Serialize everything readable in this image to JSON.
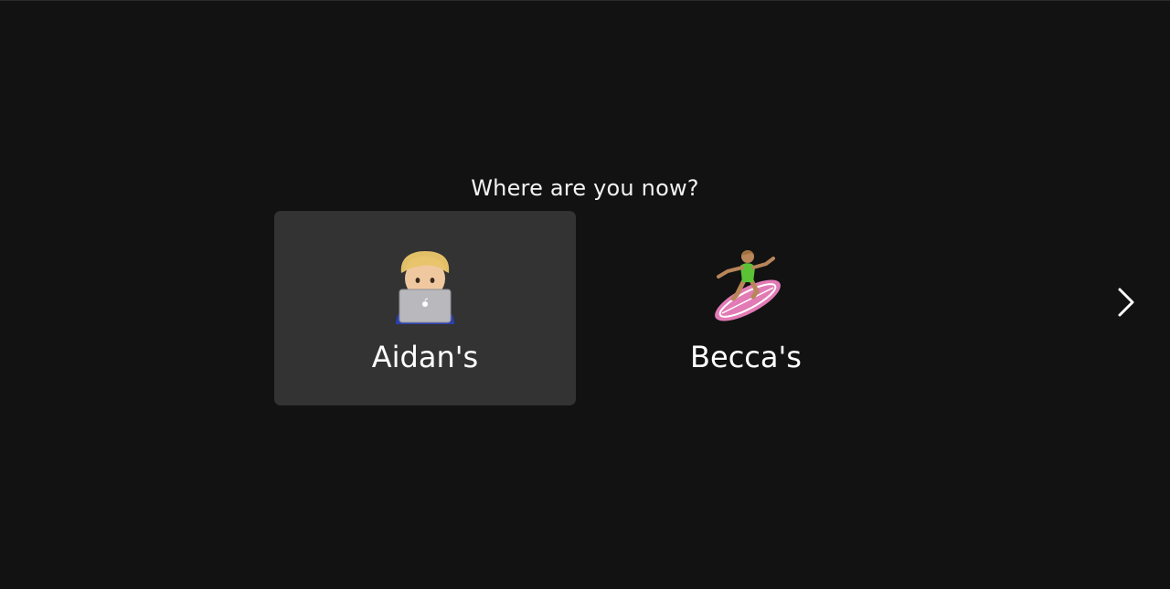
{
  "prompt": "Where are you now?",
  "options": [
    {
      "label": "Aidan's",
      "icon": "person-at-laptop-icon",
      "selected": true
    },
    {
      "label": "Becca's",
      "icon": "woman-surfing-icon",
      "selected": false
    }
  ],
  "navigation": {
    "next_icon": "chevron-right-icon"
  },
  "colors": {
    "background": "#121212",
    "selected_card": "#333333",
    "text": "#ffffff"
  }
}
